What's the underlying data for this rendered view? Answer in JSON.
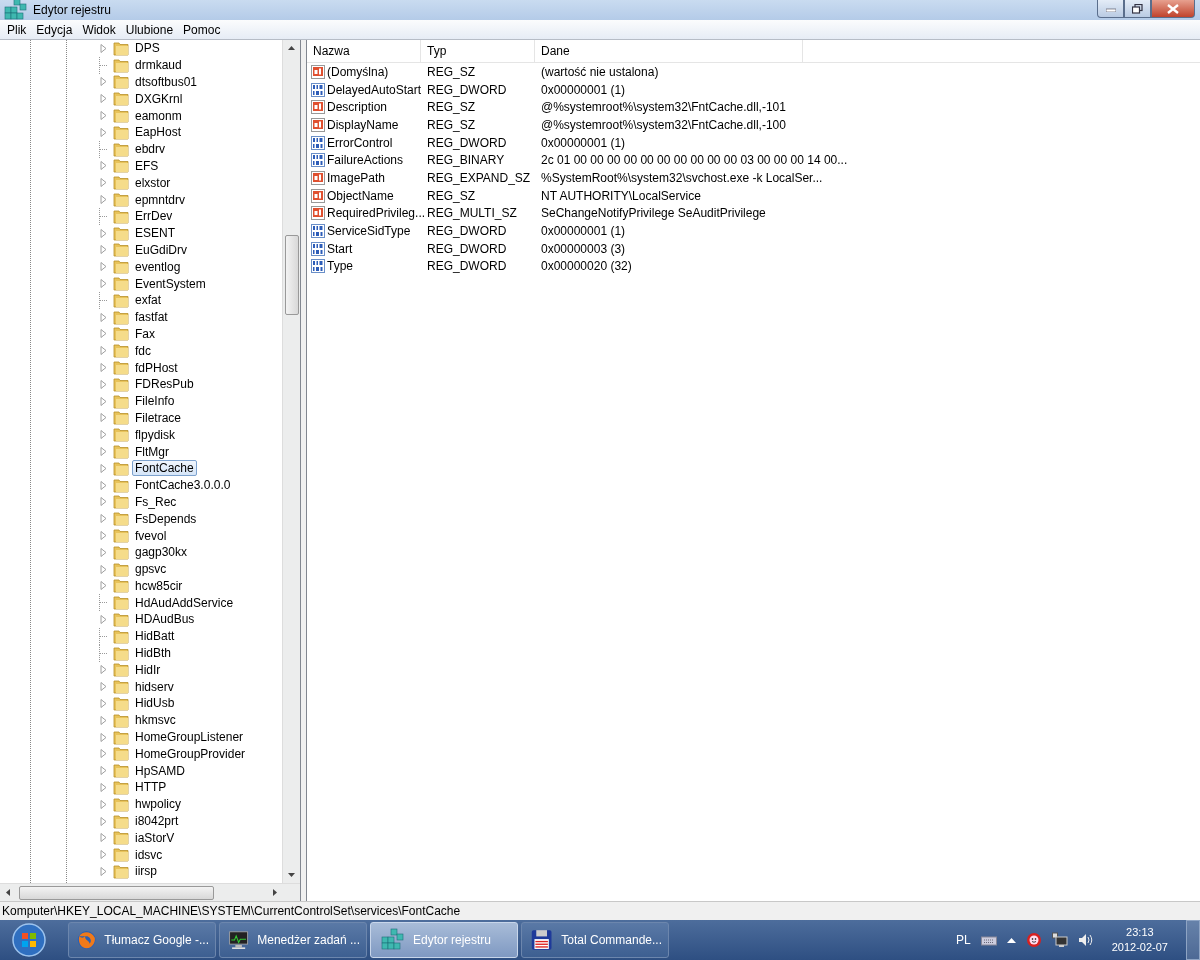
{
  "window": {
    "title": "Edytor rejestru"
  },
  "menu": [
    "Plik",
    "Edycja",
    "Widok",
    "Ulubione",
    "Pomoc"
  ],
  "tree": {
    "items": [
      {
        "label": "DPS",
        "expandable": true,
        "selected": false
      },
      {
        "label": "drmkaud",
        "expandable": false,
        "selected": false
      },
      {
        "label": "dtsoftbus01",
        "expandable": true,
        "selected": false
      },
      {
        "label": "DXGKrnl",
        "expandable": true,
        "selected": false
      },
      {
        "label": "eamonm",
        "expandable": true,
        "selected": false
      },
      {
        "label": "EapHost",
        "expandable": true,
        "selected": false
      },
      {
        "label": "ebdrv",
        "expandable": false,
        "selected": false
      },
      {
        "label": "EFS",
        "expandable": true,
        "selected": false
      },
      {
        "label": "elxstor",
        "expandable": true,
        "selected": false
      },
      {
        "label": "epmntdrv",
        "expandable": true,
        "selected": false
      },
      {
        "label": "ErrDev",
        "expandable": false,
        "selected": false
      },
      {
        "label": "ESENT",
        "expandable": true,
        "selected": false
      },
      {
        "label": "EuGdiDrv",
        "expandable": true,
        "selected": false
      },
      {
        "label": "eventlog",
        "expandable": true,
        "selected": false
      },
      {
        "label": "EventSystem",
        "expandable": true,
        "selected": false
      },
      {
        "label": "exfat",
        "expandable": false,
        "selected": false
      },
      {
        "label": "fastfat",
        "expandable": true,
        "selected": false
      },
      {
        "label": "Fax",
        "expandable": true,
        "selected": false
      },
      {
        "label": "fdc",
        "expandable": true,
        "selected": false
      },
      {
        "label": "fdPHost",
        "expandable": true,
        "selected": false
      },
      {
        "label": "FDResPub",
        "expandable": true,
        "selected": false
      },
      {
        "label": "FileInfo",
        "expandable": true,
        "selected": false
      },
      {
        "label": "Filetrace",
        "expandable": true,
        "selected": false
      },
      {
        "label": "flpydisk",
        "expandable": true,
        "selected": false
      },
      {
        "label": "FltMgr",
        "expandable": true,
        "selected": false
      },
      {
        "label": "FontCache",
        "expandable": true,
        "selected": true
      },
      {
        "label": "FontCache3.0.0.0",
        "expandable": true,
        "selected": false
      },
      {
        "label": "Fs_Rec",
        "expandable": true,
        "selected": false
      },
      {
        "label": "FsDepends",
        "expandable": true,
        "selected": false
      },
      {
        "label": "fvevol",
        "expandable": true,
        "selected": false
      },
      {
        "label": "gagp30kx",
        "expandable": true,
        "selected": false
      },
      {
        "label": "gpsvc",
        "expandable": true,
        "selected": false
      },
      {
        "label": "hcw85cir",
        "expandable": true,
        "selected": false
      },
      {
        "label": "HdAudAddService",
        "expandable": false,
        "selected": false
      },
      {
        "label": "HDAudBus",
        "expandable": true,
        "selected": false
      },
      {
        "label": "HidBatt",
        "expandable": false,
        "selected": false
      },
      {
        "label": "HidBth",
        "expandable": false,
        "selected": false
      },
      {
        "label": "HidIr",
        "expandable": true,
        "selected": false
      },
      {
        "label": "hidserv",
        "expandable": true,
        "selected": false
      },
      {
        "label": "HidUsb",
        "expandable": true,
        "selected": false
      },
      {
        "label": "hkmsvc",
        "expandable": true,
        "selected": false
      },
      {
        "label": "HomeGroupListener",
        "expandable": true,
        "selected": false
      },
      {
        "label": "HomeGroupProvider",
        "expandable": true,
        "selected": false
      },
      {
        "label": "HpSAMD",
        "expandable": true,
        "selected": false
      },
      {
        "label": "HTTP",
        "expandable": true,
        "selected": false
      },
      {
        "label": "hwpolicy",
        "expandable": true,
        "selected": false
      },
      {
        "label": "i8042prt",
        "expandable": true,
        "selected": false
      },
      {
        "label": "iaStorV",
        "expandable": true,
        "selected": false
      },
      {
        "label": "idsvc",
        "expandable": true,
        "selected": false
      },
      {
        "label": "iirsp",
        "expandable": true,
        "selected": false
      }
    ]
  },
  "values": {
    "columns": [
      "Nazwa",
      "Typ",
      "Dane"
    ],
    "rows": [
      {
        "kind": "string",
        "name": "(Domyślna)",
        "type": "REG_SZ",
        "data": "(wartość nie ustalona)"
      },
      {
        "kind": "binary",
        "name": "DelayedAutoStart",
        "type": "REG_DWORD",
        "data": "0x00000001 (1)"
      },
      {
        "kind": "string",
        "name": "Description",
        "type": "REG_SZ",
        "data": "@%systemroot%\\system32\\FntCache.dll,-101"
      },
      {
        "kind": "string",
        "name": "DisplayName",
        "type": "REG_SZ",
        "data": "@%systemroot%\\system32\\FntCache.dll,-100"
      },
      {
        "kind": "binary",
        "name": "ErrorControl",
        "type": "REG_DWORD",
        "data": "0x00000001 (1)"
      },
      {
        "kind": "binary",
        "name": "FailureActions",
        "type": "REG_BINARY",
        "data": "2c 01 00 00 00 00 00 00 00 00 00 00 03 00 00 00 14 00..."
      },
      {
        "kind": "string",
        "name": "ImagePath",
        "type": "REG_EXPAND_SZ",
        "data": "%SystemRoot%\\system32\\svchost.exe -k LocalSer..."
      },
      {
        "kind": "string",
        "name": "ObjectName",
        "type": "REG_SZ",
        "data": "NT AUTHORITY\\LocalService"
      },
      {
        "kind": "string",
        "name": "RequiredPrivileg...",
        "type": "REG_MULTI_SZ",
        "data": "SeChangeNotifyPrivilege SeAuditPrivilege"
      },
      {
        "kind": "binary",
        "name": "ServiceSidType",
        "type": "REG_DWORD",
        "data": "0x00000001 (1)"
      },
      {
        "kind": "binary",
        "name": "Start",
        "type": "REG_DWORD",
        "data": "0x00000003 (3)"
      },
      {
        "kind": "binary",
        "name": "Type",
        "type": "REG_DWORD",
        "data": "0x00000020 (32)"
      }
    ]
  },
  "status_bar": "Komputer\\HKEY_LOCAL_MACHINE\\SYSTEM\\CurrentControlSet\\services\\FontCache",
  "taskbar": {
    "tasks": [
      {
        "kind": "browser",
        "label": "Tłumacz Google -...",
        "selected": false
      },
      {
        "kind": "monitor",
        "label": "Menedżer zadań ...",
        "selected": false
      },
      {
        "kind": "registry",
        "label": "Edytor rejestru",
        "selected": true
      },
      {
        "kind": "disk",
        "label": "Total Commande...",
        "selected": false
      }
    ],
    "tray": {
      "language": "PL",
      "time": "23:13",
      "date": "2012-02-07"
    }
  }
}
